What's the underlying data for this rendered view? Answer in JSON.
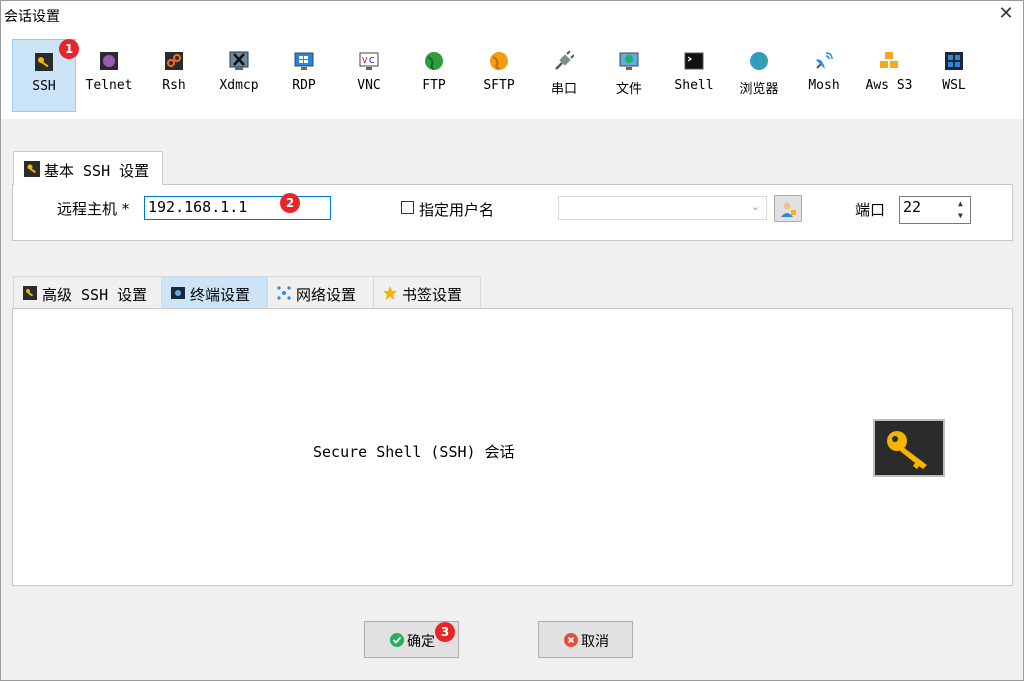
{
  "window": {
    "title": "会话设置",
    "close": "✕"
  },
  "session_types": [
    {
      "label": "SSH",
      "icon": "ssh-key-icon"
    },
    {
      "label": "Telnet",
      "icon": "telnet-icon"
    },
    {
      "label": "Rsh",
      "icon": "rsh-icon"
    },
    {
      "label": "Xdmcp",
      "icon": "xdmcp-icon"
    },
    {
      "label": "RDP",
      "icon": "rdp-icon"
    },
    {
      "label": "VNC",
      "icon": "vnc-icon"
    },
    {
      "label": "FTP",
      "icon": "ftp-globe-icon"
    },
    {
      "label": "SFTP",
      "icon": "sftp-globe-icon"
    },
    {
      "label": "串口",
      "icon": "serial-plug-icon"
    },
    {
      "label": "文件",
      "icon": "file-monitor-icon"
    },
    {
      "label": "Shell",
      "icon": "shell-terminal-icon"
    },
    {
      "label": "浏览器",
      "icon": "browser-globe-icon"
    },
    {
      "label": "Mosh",
      "icon": "mosh-satellite-icon"
    },
    {
      "label": "Aws S3",
      "icon": "aws-s3-cubes-icon"
    },
    {
      "label": "WSL",
      "icon": "wsl-windows-icon"
    }
  ],
  "active_session": "SSH",
  "badges": [
    "1",
    "2",
    "3"
  ],
  "basic": {
    "tab_label": "基本 SSH 设置",
    "host_label": "远程主机 *",
    "host_value": "192.168.1.1",
    "user_label": "指定用户名",
    "user_checked": false,
    "user_value": "",
    "port_label": "端口",
    "port_value": "22"
  },
  "advanced_tabs": [
    {
      "label": "高级 SSH 设置",
      "icon": "ssh-key-icon"
    },
    {
      "label": "终端设置",
      "icon": "terminal-icon"
    },
    {
      "label": "网络设置",
      "icon": "network-icon"
    },
    {
      "label": "书签设置",
      "icon": "star-icon"
    }
  ],
  "active_advanced_tab": "终端设置",
  "panel_description": "Secure Shell (SSH) 会话",
  "buttons": {
    "ok": "确定",
    "cancel": "取消"
  },
  "colors": {
    "accent": "#cce4f7",
    "badge": "#e8262a",
    "key_gold": "#f4b400"
  }
}
